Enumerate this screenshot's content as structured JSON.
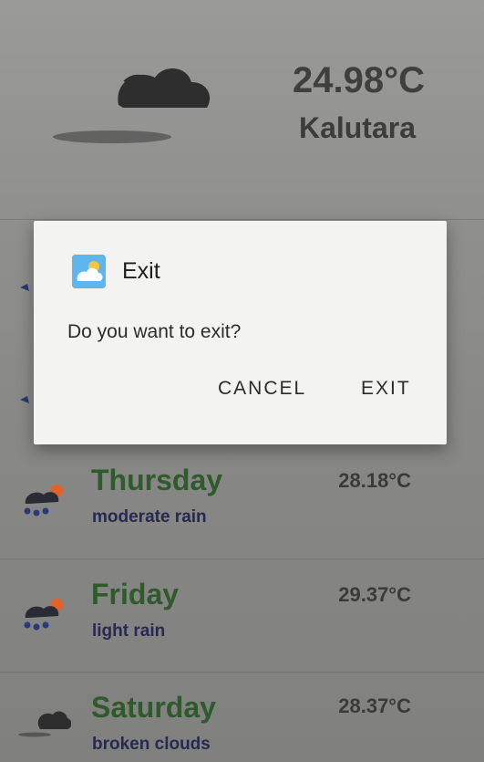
{
  "current": {
    "temperature": "24.98°C",
    "city": "Kalutara",
    "icon": "broken-clouds-icon"
  },
  "forecast": [
    {
      "day": "Thursday",
      "description": "moderate rain",
      "temperature": "28.18°C",
      "icon": "rain-sun-icon"
    },
    {
      "day": "Friday",
      "description": "light rain",
      "temperature": "29.37°C",
      "icon": "rain-sun-icon"
    },
    {
      "day": "Saturday",
      "description": "broken clouds",
      "temperature": "28.37°C",
      "icon": "broken-clouds-icon"
    }
  ],
  "dialog": {
    "title": "Exit",
    "message": "Do you want to exit?",
    "cancel_label": "CANCEL",
    "exit_label": "EXIT",
    "icon": "cloud-app-icon"
  },
  "colors": {
    "day_text": "#2f5a2b",
    "description_text": "#262a52",
    "dialog_background": "#f3f3f1",
    "app_icon_accent": "#5eb6ec"
  }
}
